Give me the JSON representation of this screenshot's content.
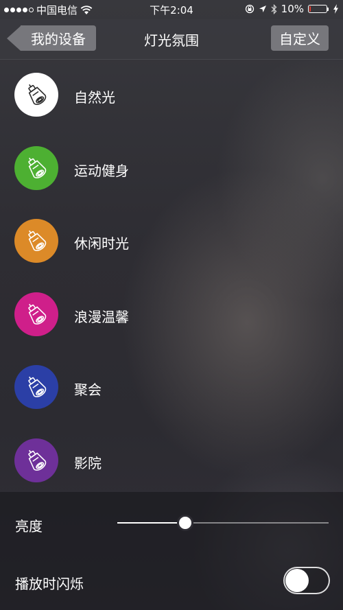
{
  "status_bar": {
    "carrier": "中国电信",
    "time": "下午2:04",
    "battery": "10%",
    "battery_level": 0.1,
    "battery_color": "#e33b2f",
    "icons": [
      "signal-dots",
      "wifi-icon",
      "lock-rotation-icon",
      "location-arrow-icon",
      "bluetooth-icon",
      "battery-icon",
      "charging-bolt-icon"
    ]
  },
  "nav": {
    "back_label": "我的设备",
    "title": "灯光氛围",
    "custom_label": "自定义"
  },
  "scenes": [
    {
      "label": "自然光",
      "color": "#ffffff",
      "icon": "bulb-icon",
      "icon_color": "#2a2a2a"
    },
    {
      "label": "运动健身",
      "color": "#4db032",
      "icon": "bulb-icon",
      "icon_color": "#ffffff"
    },
    {
      "label": "休闲时光",
      "color": "#dc8a28",
      "icon": "bulb-icon",
      "icon_color": "#ffffff"
    },
    {
      "label": "浪漫温馨",
      "color": "#cf1f8a",
      "icon": "bulb-icon",
      "icon_color": "#ffffff"
    },
    {
      "label": "聚会",
      "color": "#2b3fa6",
      "icon": "bulb-icon",
      "icon_color": "#ffffff"
    },
    {
      "label": "影院",
      "color": "#6e3099",
      "icon": "bulb-icon",
      "icon_color": "#ffffff"
    }
  ],
  "controls": {
    "brightness_label": "亮度",
    "brightness_value": 0.32,
    "flash_label": "播放时闪烁",
    "flash_on": false
  }
}
